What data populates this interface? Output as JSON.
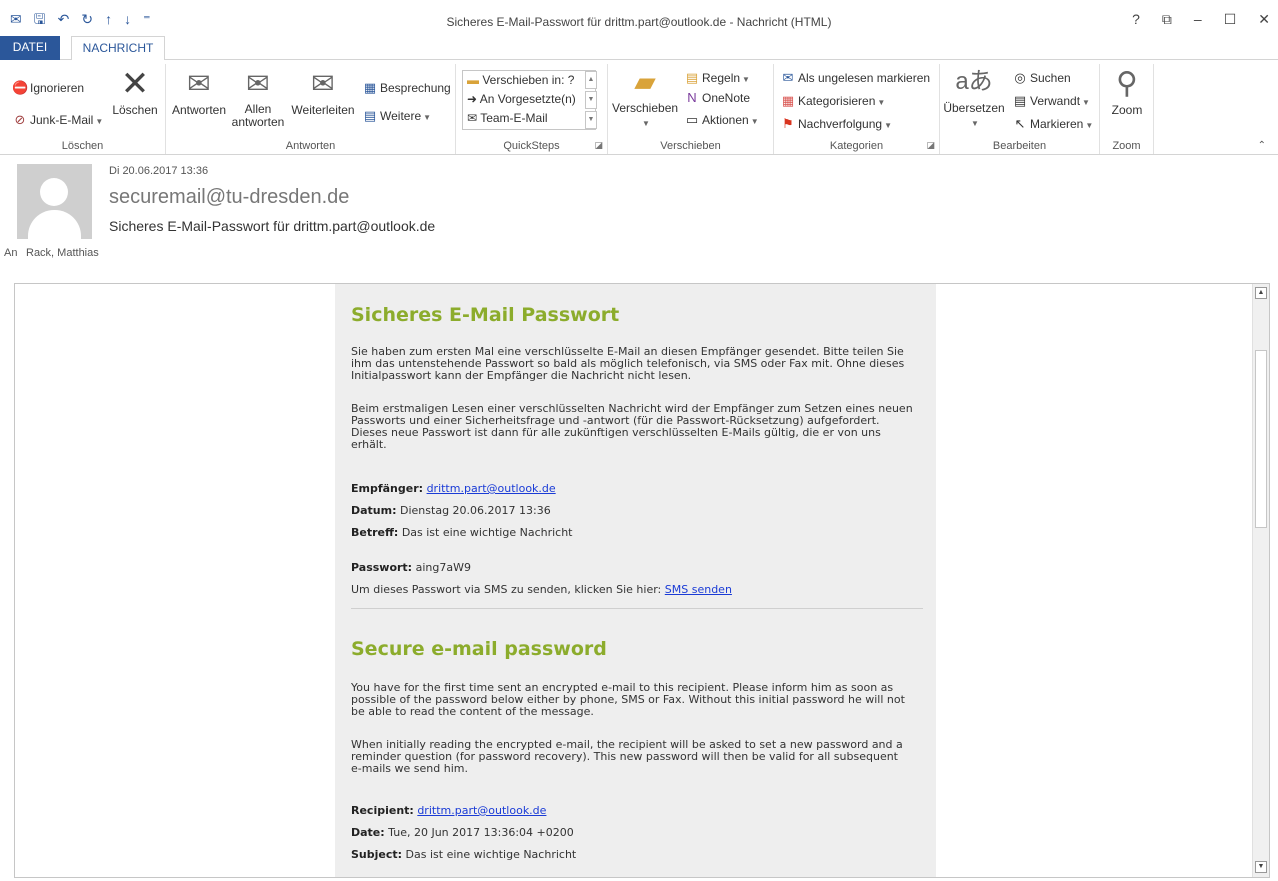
{
  "window": {
    "title": "Sicheres E-Mail-Passwort für drittm.part@outlook.de - Nachricht (HTML)",
    "help": "?",
    "controls": [
      "⧉",
      "–",
      "☐",
      "✕"
    ]
  },
  "qat": [
    "✉",
    "🖫",
    "↶",
    "↻",
    "↑",
    "↓",
    "⁼"
  ],
  "tabs": {
    "file": "DATEI",
    "message": "NACHRICHT"
  },
  "ribbon": {
    "loeschen": {
      "label": "Löschen",
      "ignore": "Ignorieren",
      "junk": "Junk-E-Mail",
      "delete": "Löschen"
    },
    "antworten": {
      "label": "Antworten",
      "reply": "Antworten",
      "reply_all_1": "Allen",
      "reply_all_2": "antworten",
      "forward": "Weiterleiten",
      "meeting": "Besprechung",
      "more": "Weitere"
    },
    "quicksteps": {
      "label": "QuickSteps",
      "items": [
        "Verschieben in: ?",
        "An Vorgesetzte(n)",
        "Team-E-Mail"
      ]
    },
    "verschieben": {
      "label": "Verschieben",
      "move": "Verschieben",
      "rules": "Regeln",
      "onenote": "OneNote",
      "actions": "Aktionen"
    },
    "kategorien": {
      "label": "Kategorien",
      "unread": "Als ungelesen markieren",
      "categorize": "Kategorisieren",
      "followup": "Nachverfolgung"
    },
    "bearbeiten": {
      "label": "Bearbeiten",
      "translate": "Übersetzen",
      "search": "Suchen",
      "related": "Verwandt",
      "select": "Markieren"
    },
    "zoom": {
      "label": "Zoom",
      "zoom": "Zoom"
    }
  },
  "header": {
    "date": "Di 20.06.2017 13:36",
    "sender": "securemail@tu-dresden.de",
    "subject": "Sicheres E-Mail-Passwort für drittm.part@outlook.de",
    "to_label": "An",
    "to": "Rack, Matthias"
  },
  "body": {
    "de": {
      "heading": "Sicheres E-Mail Passwort",
      "p1_l1": "Sie haben zum ersten Mal eine verschlüsselte E-Mail an diesen Empfänger gesendet. Bitte teilen Sie",
      "p1_l2": "ihm das untenstehende Passwort so bald als möglich telefonisch, via SMS oder Fax mit. Ohne dieses",
      "p1_l3": "Initialpasswort kann der Empfänger die Nachricht nicht lesen.",
      "p2_l1": "Beim erstmaligen Lesen einer verschlüsselten Nachricht wird der Empfänger zum Setzen eines neuen",
      "p2_l2": "Passworts und einer Sicherheitsfrage und -antwort (für die Passwort-Rücksetzung) aufgefordert.",
      "p2_l3": "Dieses neue Passwort ist dann für alle zukünftigen verschlüsselten E-Mails gültig, die er von uns",
      "p2_l4": "erhält.",
      "recipient_label": "Empfänger:",
      "recipient": "drittm.part@outlook.de",
      "date_label": "Datum:",
      "date": "Dienstag 20.06.2017 13:36",
      "subject_label": "Betreff:",
      "subject": "Das ist eine wichtige Nachricht",
      "password_label": "Passwort:",
      "password": "aing7aW9",
      "sms_text": "Um dieses Passwort via SMS zu senden, klicken Sie hier:",
      "sms_link": "SMS senden"
    },
    "en": {
      "heading": "Secure e-mail password",
      "p1_l1": "You have for the first time sent an encrypted e-mail to this recipient. Please inform him as soon as",
      "p1_l2": "possible of the password below either by phone, SMS or Fax. Without this initial password he will not",
      "p1_l3": "be able to read the content of the message.",
      "p2_l1": "When initially reading the encrypted e-mail, the recipient will be asked to set a new password and a",
      "p2_l2": "reminder question (for password recovery). This new password will then be valid for all subsequent",
      "p2_l3": "e-mails we send him.",
      "recipient_label": "Recipient:",
      "recipient": "drittm.part@outlook.de",
      "date_label": "Date:",
      "date": "Tue, 20 Jun 2017 13:36:04 +0200",
      "subject_label": "Subject:",
      "subject": "Das ist eine wichtige Nachricht"
    }
  },
  "colors": {
    "accent": "#2b579a",
    "heading_green": "#8cac2c",
    "link": "#1a3bd6",
    "content_bg": "#eeeeee"
  }
}
